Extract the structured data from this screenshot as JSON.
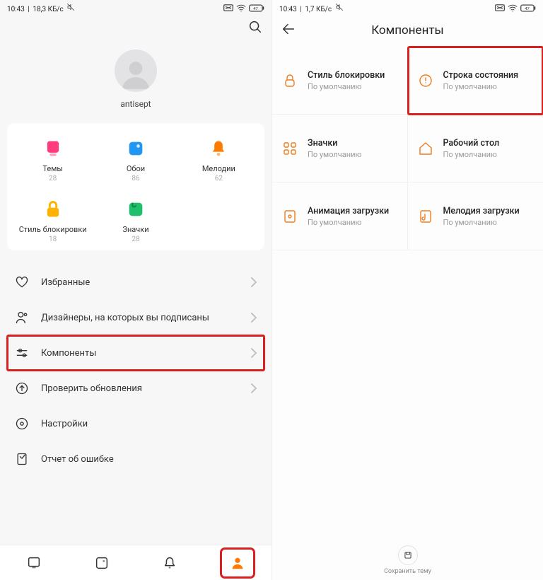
{
  "left": {
    "status": {
      "time": "10:43",
      "net": "18,3 КБ/с",
      "battery": "47"
    },
    "profile": {
      "username": "antisept"
    },
    "grid": [
      {
        "label": "Темы",
        "count": "28",
        "icon": "themes"
      },
      {
        "label": "Обои",
        "count": "86",
        "icon": "wallpapers"
      },
      {
        "label": "Мелодии",
        "count": "62",
        "icon": "ringtones"
      },
      {
        "label": "Стиль блокировки",
        "count": "18",
        "icon": "lockstyle"
      },
      {
        "label": "Значки",
        "count": "28",
        "icon": "icons"
      }
    ],
    "menu": [
      {
        "label": "Избранные",
        "icon": "heart"
      },
      {
        "label": "Дизайнеры, на которых вы подписаны",
        "icon": "person"
      },
      {
        "label": "Компоненты",
        "icon": "sliders",
        "highlight": true
      },
      {
        "label": "Проверить обновления",
        "icon": "update"
      },
      {
        "label": "Настройки",
        "icon": "settings"
      },
      {
        "label": "Отчет об ошибке",
        "icon": "report"
      }
    ],
    "nav_active": 3
  },
  "right": {
    "status": {
      "time": "10:43",
      "net": "1,7 КБ/с",
      "battery": "47"
    },
    "title": "Компоненты",
    "components": [
      {
        "title": "Стиль блокировки",
        "sub": "По умолчанию",
        "icon": "lock"
      },
      {
        "title": "Строка состояния",
        "sub": "По умолчанию",
        "icon": "statusbar",
        "highlight": true
      },
      {
        "title": "Значки",
        "sub": "По умолчанию",
        "icon": "grid"
      },
      {
        "title": "Рабочий стол",
        "sub": "По умолчанию",
        "icon": "home"
      },
      {
        "title": "Анимация загрузки",
        "sub": "По умолчанию",
        "icon": "bootanim"
      },
      {
        "title": "Мелодия загрузки",
        "sub": "По умолчанию",
        "icon": "bootsound"
      }
    ],
    "footer_label": "Сохранить тему"
  }
}
